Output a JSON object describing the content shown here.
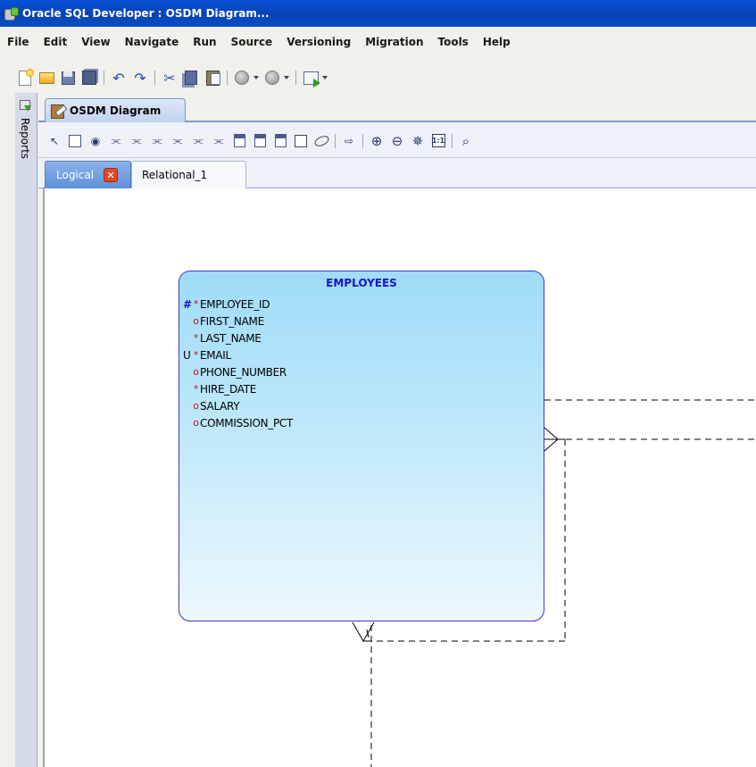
{
  "window": {
    "title": "Oracle SQL Developer : OSDM Diagram..."
  },
  "menubar": {
    "items": [
      {
        "label": "File"
      },
      {
        "label": "Edit"
      },
      {
        "label": "View"
      },
      {
        "label": "Navigate"
      },
      {
        "label": "Run"
      },
      {
        "label": "Source"
      },
      {
        "label": "Versioning"
      },
      {
        "label": "Migration"
      },
      {
        "label": "Tools"
      },
      {
        "label": "Help"
      }
    ]
  },
  "toolbar": {
    "icons": [
      "new-file-icon",
      "open-folder-icon",
      "save-icon",
      "save-all-icon",
      "undo-icon",
      "redo-icon",
      "cut-icon",
      "copy-icon",
      "paste-icon",
      "back-icon",
      "forward-icon",
      "sql-worksheet-icon"
    ]
  },
  "sidepanel": {
    "label": "Reports"
  },
  "editor": {
    "tab_label": "OSDM Diagram"
  },
  "model_tabs": {
    "active": "Logical",
    "inactive": "Relational_1"
  },
  "entity": {
    "name": "EMPLOYEES",
    "attributes": [
      {
        "key": "#",
        "mark": "*",
        "name": "EMPLOYEE_ID"
      },
      {
        "key": "",
        "mark": "o",
        "name": "FIRST_NAME"
      },
      {
        "key": "",
        "mark": "*",
        "name": "LAST_NAME"
      },
      {
        "key": "U",
        "mark": "*",
        "name": "EMAIL"
      },
      {
        "key": "",
        "mark": "o",
        "name": "PHONE_NUMBER"
      },
      {
        "key": "",
        "mark": "*",
        "name": "HIRE_DATE"
      },
      {
        "key": "",
        "mark": "o",
        "name": "SALARY"
      },
      {
        "key": "",
        "mark": "o",
        "name": "COMMISSION_PCT"
      }
    ]
  },
  "colors": {
    "title_bar": "#0842b4",
    "entity_border": "#3838c8",
    "entity_fill_top": "#9fdcf8",
    "entity_title": "#1515c8",
    "required_mark": "#d01010"
  }
}
